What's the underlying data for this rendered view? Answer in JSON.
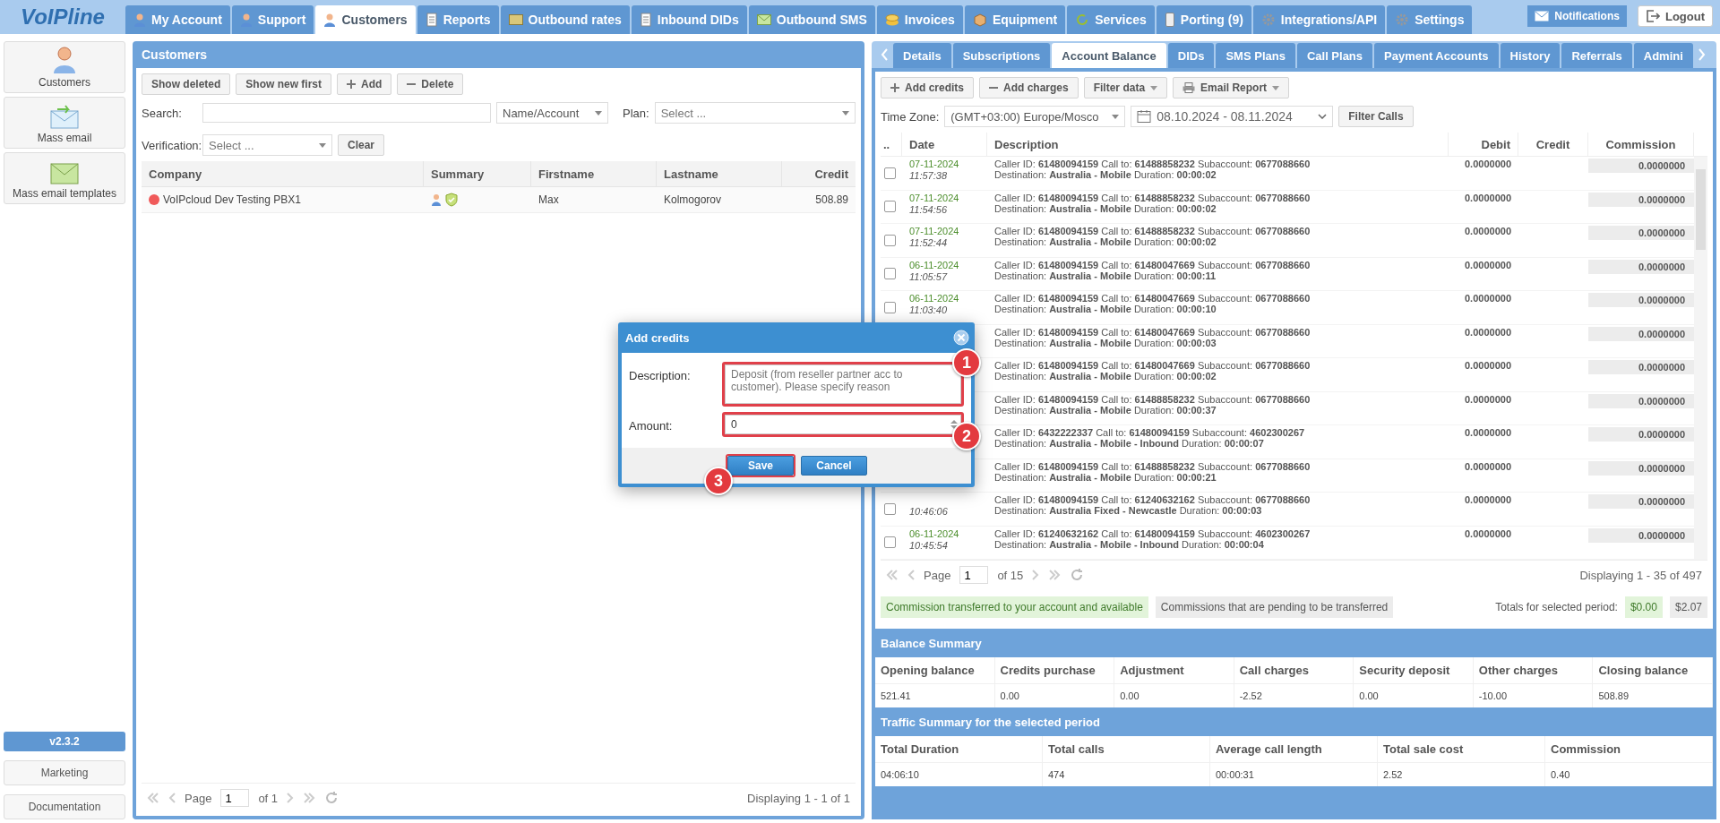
{
  "top_nav": {
    "logo": "VoIPline",
    "tabs": [
      {
        "label": "My Account",
        "selected": false
      },
      {
        "label": "Support",
        "selected": false
      },
      {
        "label": "Customers",
        "selected": true
      },
      {
        "label": "Reports",
        "selected": false
      },
      {
        "label": "Outbound rates",
        "selected": false
      },
      {
        "label": "Inbound DIDs",
        "selected": false
      },
      {
        "label": "Outbound SMS",
        "selected": false
      },
      {
        "label": "Invoices",
        "selected": false
      },
      {
        "label": "Equipment",
        "selected": false
      },
      {
        "label": "Services",
        "selected": false
      },
      {
        "label": "Porting (9)",
        "selected": false
      },
      {
        "label": "Integrations/API",
        "selected": false
      },
      {
        "label": "Settings",
        "selected": false
      }
    ],
    "notifications": "Notifications",
    "logout": "Logout"
  },
  "sidebar": {
    "items": [
      "Customers",
      "Mass email",
      "Mass email templates"
    ],
    "version": "v2.3.2",
    "links": [
      "Marketing",
      "Documentation"
    ]
  },
  "customers_panel": {
    "title": "Customers",
    "toolbar": [
      "Show deleted",
      "Show new first",
      "Add",
      "Delete"
    ],
    "search_label": "Search:",
    "search_by": "Name/Account",
    "plan_label": "Plan:",
    "plan_placeholder": "Select ...",
    "verification_label": "Verification:",
    "verification_placeholder": "Select ...",
    "clear": "Clear",
    "columns": [
      "Company",
      "Summary",
      "Firstname",
      "Lastname",
      "Credit"
    ],
    "rows": [
      {
        "company": "VoIPcloud Dev Testing PBX1",
        "color": "#f05a5a",
        "firstname": "Max",
        "lastname": "Kolmogorov",
        "credit": "508.89"
      }
    ],
    "pager": {
      "page_label": "Page",
      "page": "1",
      "of": "of 1",
      "displaying": "Displaying 1 - 1 of 1"
    }
  },
  "account_panel": {
    "tabs": [
      {
        "label": "Details",
        "selected": false
      },
      {
        "label": "Subscriptions",
        "selected": false
      },
      {
        "label": "Account Balance",
        "selected": true
      },
      {
        "label": "DIDs",
        "selected": false
      },
      {
        "label": "SMS Plans",
        "selected": false
      },
      {
        "label": "Call Plans",
        "selected": false
      },
      {
        "label": "Payment Accounts",
        "selected": false
      },
      {
        "label": "History",
        "selected": false
      },
      {
        "label": "Referrals",
        "selected": false
      },
      {
        "label": "Admini",
        "selected": false
      }
    ],
    "toolbar": [
      "Add credits",
      "Add charges",
      "Filter data",
      "Email Report"
    ],
    "timezone_label": "Time Zone:",
    "timezone": "(GMT+03:00) Europe/Mosco",
    "date_range": "08.10.2024 - 08.11.2024",
    "filter_calls": "Filter Calls",
    "columns": [
      "..",
      "Date",
      "Description",
      "Debit",
      "Credit",
      "Commission"
    ],
    "rows": [
      {
        "checked": false,
        "date": "07-11-2024",
        "time": "11:57:38",
        "line1": "Caller ID: **61480094159** Call to: **61488858232** Subaccount: **0677088660**",
        "line2": "Destination: **Australia - Mobile** Duration: **00:00:02**",
        "debit": "0.0000000",
        "commission": "0.0000000"
      },
      {
        "checked": false,
        "date": "07-11-2024",
        "time": "11:54:56",
        "line1": "Caller ID: **61480094159** Call to: **61488858232** Subaccount: **0677088660**",
        "line2": "Destination: **Australia - Mobile** Duration: **00:00:02**",
        "debit": "0.0000000",
        "commission": "0.0000000"
      },
      {
        "checked": false,
        "date": "07-11-2024",
        "time": "11:52:44",
        "line1": "Caller ID: **61480094159** Call to: **61488858232** Subaccount: **0677088660**",
        "line2": "Destination: **Australia - Mobile** Duration: **00:00:02**",
        "debit": "0.0000000",
        "commission": "0.0000000"
      },
      {
        "checked": false,
        "date": "06-11-2024",
        "time": "11:05:57",
        "line1": "Caller ID: **61480094159** Call to: **61480047669** Subaccount: **0677088660**",
        "line2": "Destination: **Australia - Mobile** Duration: **00:00:11**",
        "debit": "0.0000000",
        "commission": "0.0000000"
      },
      {
        "checked": false,
        "date": "06-11-2024",
        "time": "11:03:40",
        "line1": "Caller ID: **61480094159** Call to: **61480047669** Subaccount: **0677088660**",
        "line2": "Destination: **Australia - Mobile** Duration: **00:00:10**",
        "debit": "0.0000000",
        "commission": "0.0000000"
      },
      {
        "line1": "Caller ID: **61480094159** Call to: **61480047669** Subaccount: **0677088660**",
        "line2": "Destination: **Australia - Mobile** Duration: **00:00:03**",
        "debit": "0.0000000",
        "commission": "0.0000000"
      },
      {
        "line1": "Caller ID: **61480094159** Call to: **61480047669** Subaccount: **0677088660**",
        "line2": "Destination: **Australia - Mobile** Duration: **00:00:02**",
        "debit": "0.0000000",
        "commission": "0.0000000"
      },
      {
        "line1": "Caller ID: **61480094159** Call to: **61488858232** Subaccount: **0677088660**",
        "line2": "Destination: **Australia - Mobile** Duration: **00:00:37**",
        "debit": "0.0000000",
        "commission": "0.0000000"
      },
      {
        "line1": "Caller ID: **6432222337** Call to: **61480094159** Subaccount: **4602300267**",
        "line2": "Destination: **Australia - Mobile - Inbound** Duration: **00:00:07**",
        "debit": "0.0000000",
        "commission": "0.0000000"
      },
      {
        "line1": "Caller ID: **61480094159** Call to: **61488858232** Subaccount: **0677088660**",
        "line2": "Destination: **Australia - Mobile** Duration: **00:00:21**",
        "debit": "0.0000000",
        "commission": "0.0000000"
      },
      {
        "checked": false,
        "time": "10:46:06",
        "line1": "Caller ID: **61480094159** Call to: **61240632162** Subaccount: **0677088660**",
        "line2": "Destination: **Australia Fixed - Newcastle** Duration: **00:00:03**",
        "debit": "0.0000000",
        "commission": "0.0000000"
      },
      {
        "checked": false,
        "date": "06-11-2024",
        "time": "10:45:54",
        "line1": "Caller ID: **61240632162** Call to: **61480094159** Subaccount: **4602300267**",
        "line2": "Destination: **Australia - Mobile - Inbound** Duration: **00:00:04**",
        "debit": "0.0000000",
        "commission": "0.0000000"
      }
    ],
    "pager": {
      "page_label": "Page",
      "page": "1",
      "of": "of 15",
      "displaying": "Displaying 1 - 35 of 497"
    },
    "legend": {
      "transferred": "Commission transferred to your account and available",
      "pending": "Commissions that are pending to be transferred",
      "totals_label": "Totals for selected period:",
      "totals": [
        "$0.00",
        "$2.07"
      ]
    },
    "balance_summary": {
      "title": "Balance Summary",
      "columns": [
        "Opening balance",
        "Credits purchase",
        "Adjustment",
        "Call charges",
        "Security deposit",
        "Other charges",
        "Closing balance"
      ],
      "values": [
        "521.41",
        "0.00",
        "0.00",
        "-2.52",
        "0.00",
        "-10.00",
        "508.89"
      ]
    },
    "traffic_summary": {
      "title": "Traffic Summary for the selected period",
      "columns": [
        "Total Duration",
        "Total calls",
        "Average call length",
        "Total sale cost",
        "Commission"
      ],
      "values": [
        "04:06:10",
        "474",
        "00:00:31",
        "2.52",
        "0.40"
      ]
    }
  },
  "dialog": {
    "title": "Add credits",
    "description_label": "Description:",
    "description_placeholder": "Deposit (from reseller partner acc to customer). Please specify reason",
    "amount_label": "Amount:",
    "amount": "0",
    "buttons": [
      "Save",
      "Cancel"
    ],
    "annotations": [
      {
        "label": "1"
      },
      {
        "label": "2"
      },
      {
        "label": "3"
      }
    ]
  }
}
